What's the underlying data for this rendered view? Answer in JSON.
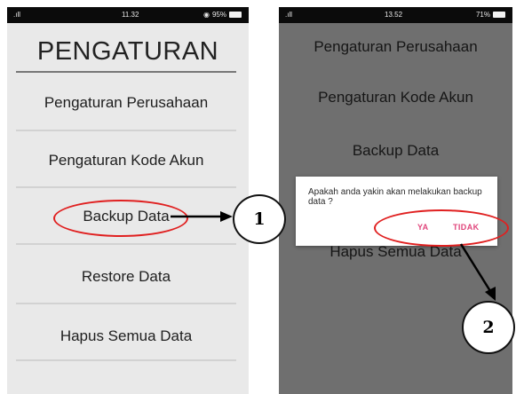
{
  "screen1": {
    "status_bar": {
      "signal": ".ıll",
      "time": "11.32",
      "battery": "95%"
    },
    "title": "PENGATURAN",
    "menu": [
      "Pengaturan Perusahaan",
      "Pengaturan Kode Akun",
      "Backup Data",
      "Restore Data",
      "Hapus Semua Data"
    ]
  },
  "screen2": {
    "status_bar": {
      "signal": ".ıll",
      "time": "13.52",
      "battery": "71%"
    },
    "menu": [
      "Pengaturan Perusahaan",
      "Pengaturan Kode Akun",
      "Backup Data",
      "Hapus Semua Data"
    ],
    "dialog": {
      "message": "Apakah anda yakin akan melakukan backup data ?",
      "yes": "YA",
      "no": "TIDAK"
    }
  },
  "annotations": {
    "step1": "1",
    "step2": "2"
  },
  "colors": {
    "highlight": "#e02020",
    "dialog_button": "#e0457b",
    "overlay": "#6f6f6f"
  }
}
